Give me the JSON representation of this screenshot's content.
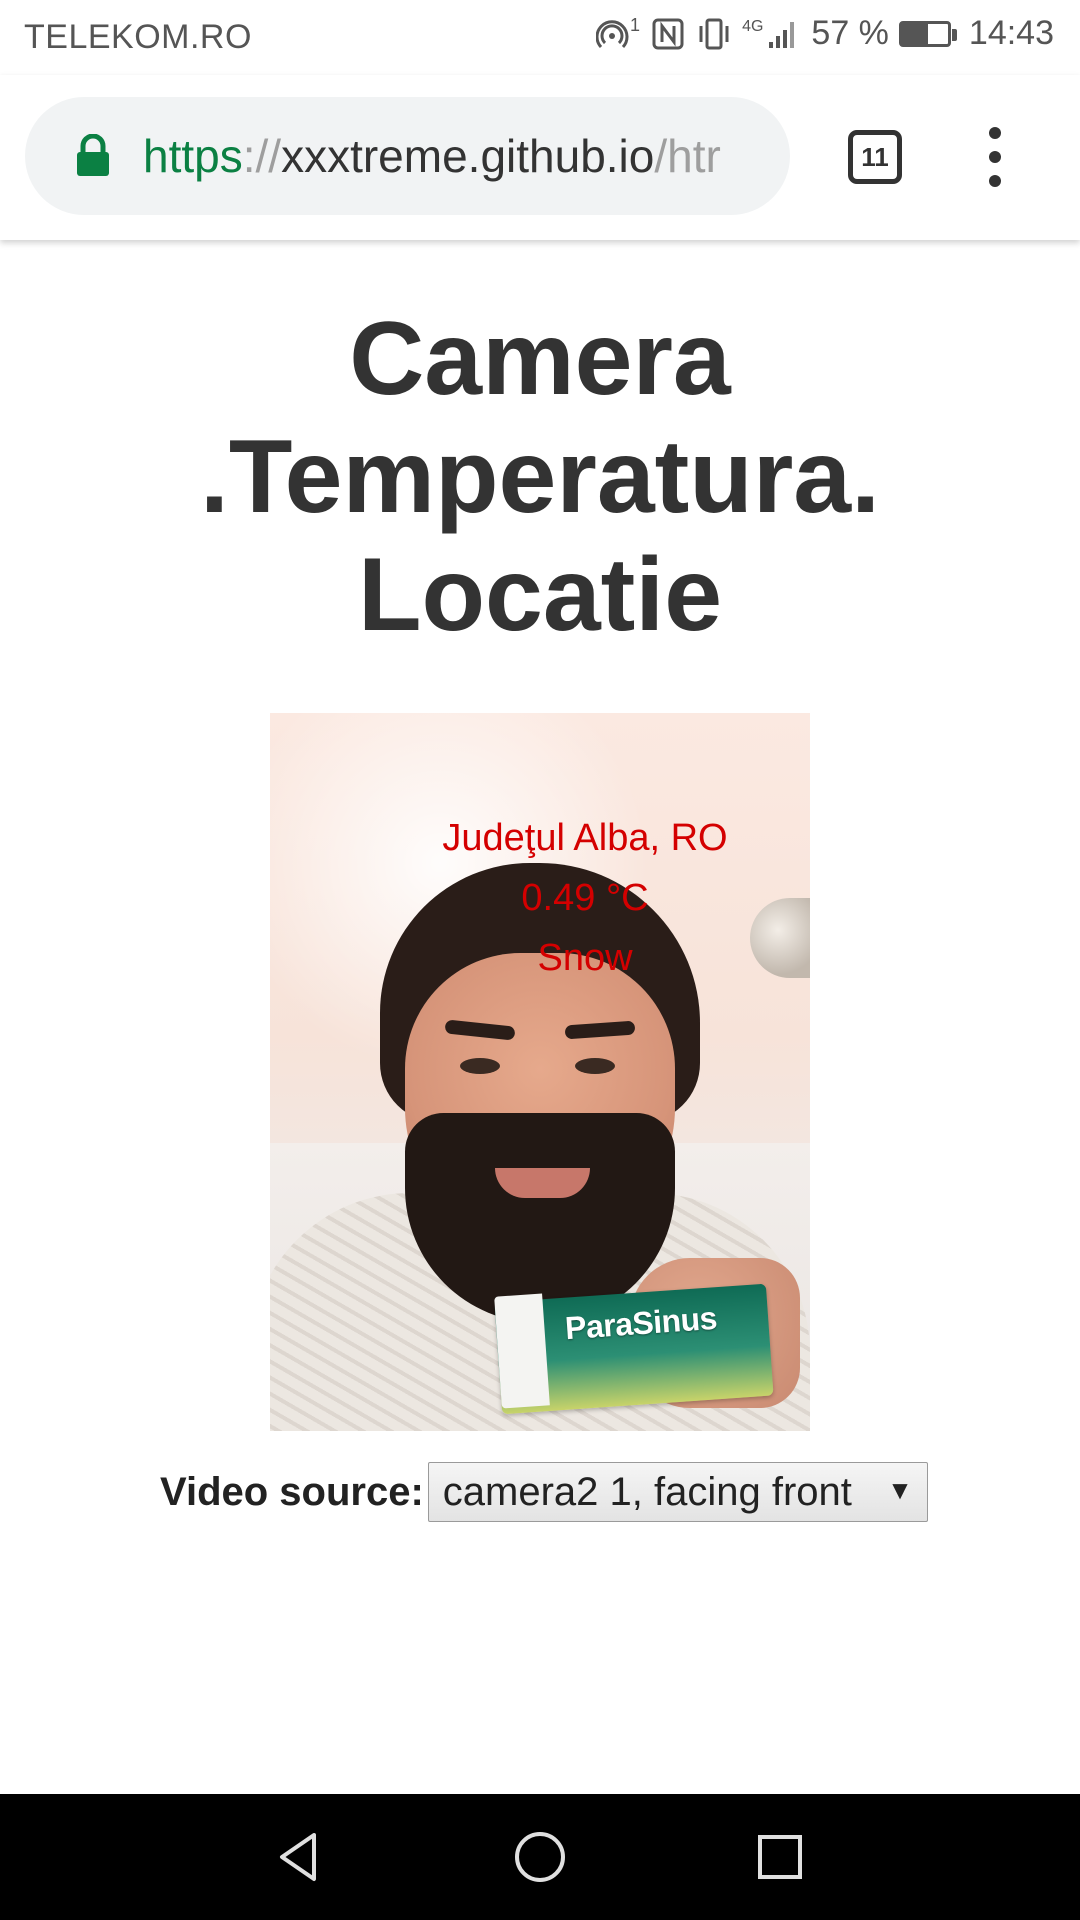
{
  "status_bar": {
    "carrier": "TELEKOM.RO",
    "nfc_icon_superscript": "1",
    "network": "4G",
    "battery_percent": "57 %",
    "battery_level": 0.57,
    "time": "14:43",
    "icons": [
      "hotspot-icon",
      "nfc-icon",
      "vibrate-icon",
      "signal-icon",
      "battery-icon"
    ]
  },
  "browser": {
    "url_scheme": "https",
    "url_separator": "://",
    "url_host": "xxxtreme.github.io",
    "url_path": "/htr",
    "tab_count": "11",
    "icons": [
      "lock-icon",
      "tabs-icon",
      "more-vert-icon"
    ],
    "secure_color": "#0b8043"
  },
  "page": {
    "title_line1": "Camera",
    "title_line2": ".Temperatura.",
    "title_line3": "Locatie"
  },
  "camera": {
    "location": "Judeţul Alba, RO",
    "temperature": "0.49 °C",
    "weather": "Snow",
    "overlay_color": "#d40000",
    "box_brand": "ParaSinus"
  },
  "video_source": {
    "label": "Video source:",
    "selected": "camera2 1, facing front"
  },
  "nav_bar": {
    "buttons": [
      "back-icon",
      "home-icon",
      "recents-icon"
    ]
  }
}
